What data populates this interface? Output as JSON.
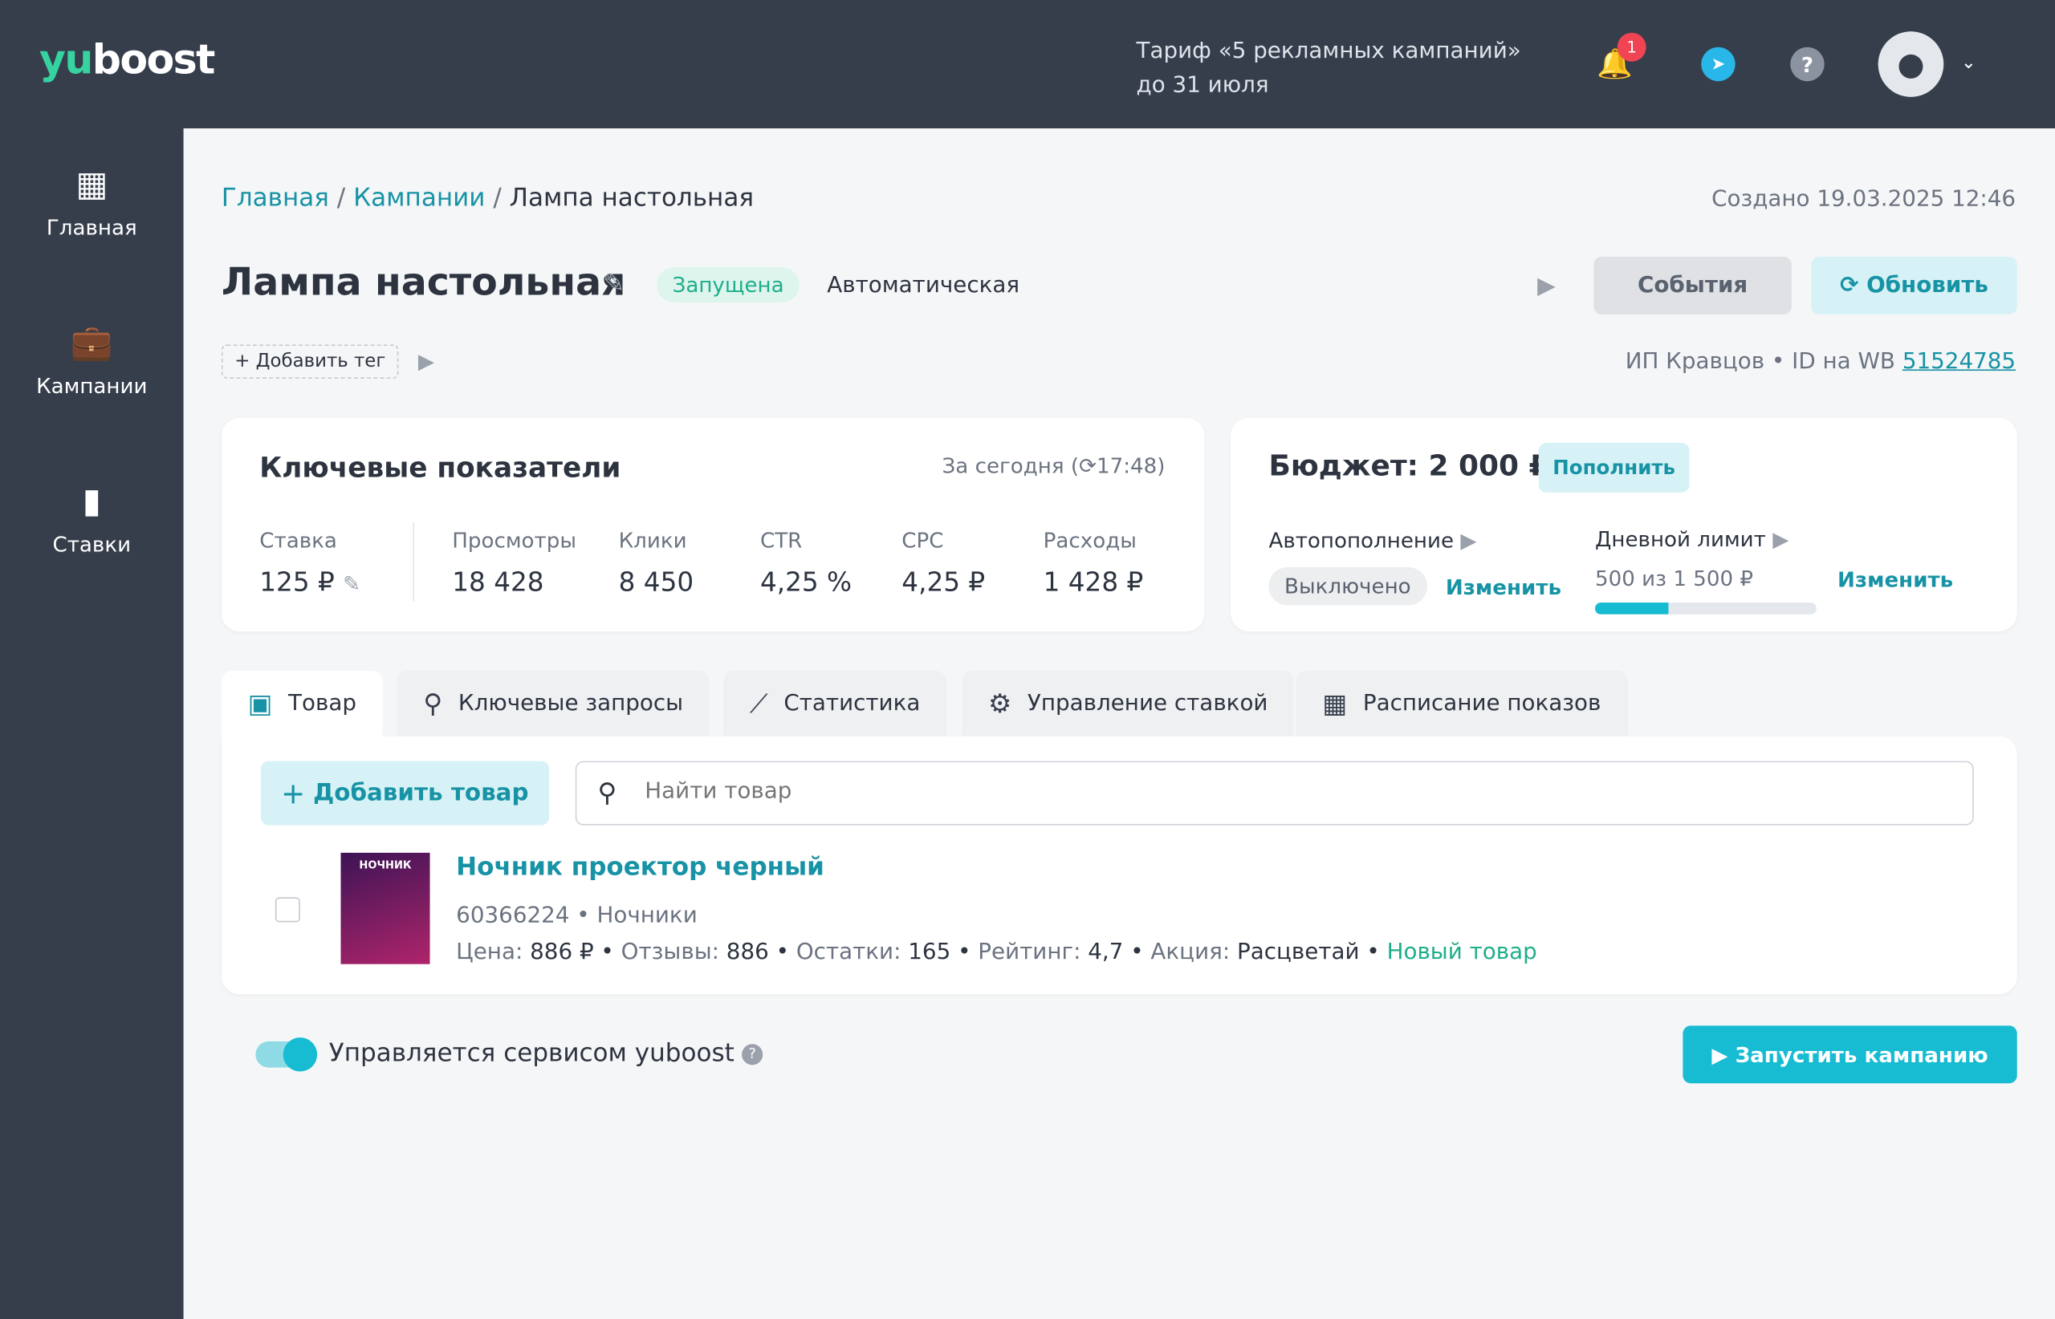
{
  "header": {
    "logo_y": "yu",
    "logo_rest": "boost",
    "tariff_line1": "Тариф «5 рекламных кампаний»",
    "tariff_line2": "до 31 июля",
    "notif_count": "1"
  },
  "sidebar": {
    "items": [
      {
        "label": "Главная"
      },
      {
        "label": "Кампании"
      },
      {
        "label": "Ставки"
      }
    ]
  },
  "breadcrumb": {
    "home": "Главная",
    "campaigns": "Кампании",
    "current": "Лампа настольная"
  },
  "created": "Создано 19.03.2025 12:46",
  "campaign": {
    "title": "Лампа настольная",
    "status": "Запущена",
    "type": "Автоматическая",
    "add_tag": "+ Добавить тег",
    "events": "События",
    "refresh": "Обновить",
    "seller": "ИП Кравцов",
    "wb_label": "ID на WB",
    "wb_id": "51524785"
  },
  "kpi": {
    "title": "Ключевые показатели",
    "period": "За сегодня (",
    "time": "17:48)",
    "bid_label": "Ставка",
    "bid": "125 ₽",
    "metrics": [
      {
        "label": "Просмотры",
        "value": "18 428"
      },
      {
        "label": "Клики",
        "value": "8 450"
      },
      {
        "label": "CTR",
        "value": "4,25 %"
      },
      {
        "label": "CPC",
        "value": "4,25 ₽"
      },
      {
        "label": "Расходы",
        "value": "1 428 ₽"
      }
    ]
  },
  "budget": {
    "title": "Бюджет: 2 000 ₽",
    "topup": "Пополнить",
    "auto_label": "Автопополнение",
    "auto_state": "Выключено",
    "change": "Изменить",
    "daily_label": "Дневной лимит",
    "daily_value": "500 из 1 500 ₽",
    "daily_progress": 0.333
  },
  "tabs": [
    {
      "label": "Товар",
      "icon": "bookmark-icon"
    },
    {
      "label": "Ключевые запросы",
      "icon": "search-icon"
    },
    {
      "label": "Статистика",
      "icon": "chart-line-icon"
    },
    {
      "label": "Управление ставкой",
      "icon": "gear-icon"
    },
    {
      "label": "Расписание показов",
      "icon": "calendar-icon"
    }
  ],
  "products": {
    "add": "Добавить товар",
    "search_placeholder": "Найти товар",
    "item": {
      "name": "Ночник проектор черный",
      "thumb_text": "НОЧНИК",
      "article": "60366224",
      "category": "Ночники",
      "price_label": "Цена:",
      "price": "886 ₽",
      "reviews_label": "Отзывы:",
      "reviews": "886",
      "stock_label": "Остатки:",
      "stock": "165",
      "rating_label": "Рейтинг:",
      "rating": "4,7",
      "promo_label": "Акция:",
      "promo": "Расцветай",
      "new": "Новый товар"
    }
  },
  "footer": {
    "managed": "Управляется сервисом yuboost",
    "launch": "Запустить кампанию"
  },
  "colors": {
    "accent": "#17bcd3",
    "dark": "#363e4c",
    "green": "#1fae8a"
  }
}
